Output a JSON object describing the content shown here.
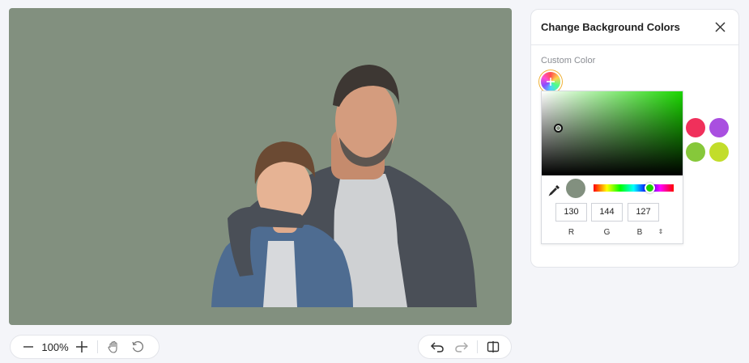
{
  "colors": {
    "background": "#82907f",
    "preset_red": "#f0305b",
    "preset_purple": "#a94fe0",
    "preset_green": "#86c83a",
    "preset_lime": "#c2dd2b"
  },
  "toolbar": {
    "zoom_label": "100%",
    "icons": [
      "minus-icon",
      "plus-icon",
      "hand-icon",
      "reset-icon",
      "undo-icon",
      "redo-icon",
      "compare-icon"
    ]
  },
  "panel": {
    "title": "Change Background Colors",
    "section_label": "Custom Color"
  },
  "picker": {
    "r": "130",
    "g": "144",
    "b": "127",
    "r_label": "R",
    "g_label": "G",
    "b_label": "B",
    "toggle_symbol": "⇕"
  }
}
